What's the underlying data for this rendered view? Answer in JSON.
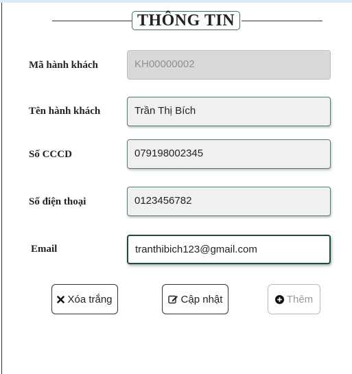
{
  "header": {
    "title": "THÔNG TIN"
  },
  "form": {
    "ma_hanh_khach": {
      "label": "Mã hành khách",
      "value": "KH00000002"
    },
    "ten_hanh_khach": {
      "label": "Tên hành khách",
      "value": "Trần Thị Bích"
    },
    "so_cccd": {
      "label": "Số CCCD",
      "value": "079198002345"
    },
    "so_dien_thoai": {
      "label": "Số điện thoại",
      "value": "0123456782"
    },
    "email": {
      "label": "Email",
      "value": "tranthibich123@gmail.com"
    }
  },
  "buttons": {
    "clear": {
      "label": "Xóa trắng",
      "icon": "close-icon"
    },
    "update": {
      "label": "Cập nhật",
      "icon": "edit-icon"
    },
    "add": {
      "label": "Thêm",
      "icon": "plus-circle-icon",
      "disabled": true
    }
  }
}
